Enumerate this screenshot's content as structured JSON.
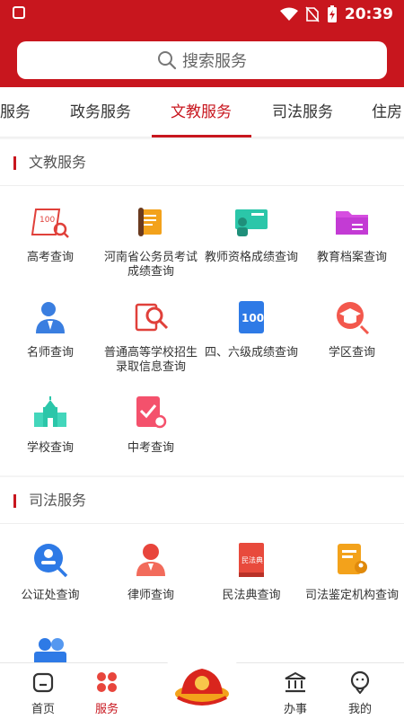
{
  "status": {
    "time": "20:39"
  },
  "search": {
    "placeholder": "搜索服务"
  },
  "tabs": [
    "服务",
    "政务服务",
    "文教服务",
    "司法服务",
    "住房"
  ],
  "sections": [
    {
      "title": "文教服务",
      "items": [
        {
          "label": "高考查询",
          "icon": "exam-paper-icon"
        },
        {
          "label": "河南省公务员考试成绩查询",
          "icon": "scroll-document-icon"
        },
        {
          "label": "教师资格成绩查询",
          "icon": "teacher-board-icon"
        },
        {
          "label": "教育档案查询",
          "icon": "folder-icon"
        },
        {
          "label": "名师查询",
          "icon": "teacher-person-icon"
        },
        {
          "label": "普通高等学校招生录取信息查询",
          "icon": "admission-search-icon"
        },
        {
          "label": "四、六级成绩查询",
          "icon": "score-100-icon"
        },
        {
          "label": "学区查询",
          "icon": "graduation-cap-icon"
        },
        {
          "label": "学校查询",
          "icon": "school-building-icon"
        },
        {
          "label": "中考查询",
          "icon": "document-check-icon"
        }
      ]
    },
    {
      "title": "司法服务",
      "items": [
        {
          "label": "公证处查询",
          "icon": "notary-icon"
        },
        {
          "label": "律师查询",
          "icon": "lawyer-icon"
        },
        {
          "label": "民法典查询",
          "icon": "civil-code-book-icon"
        },
        {
          "label": "司法鉴定机构查询",
          "icon": "judicial-appraisal-icon"
        },
        {
          "label": "",
          "icon": "video-person-icon"
        }
      ]
    }
  ],
  "civil_code_text": "民法典",
  "nav": [
    {
      "label": "首页",
      "icon": "home-icon"
    },
    {
      "label": "服务",
      "icon": "services-grid-icon"
    },
    {
      "label": "",
      "icon": "emblem-logo-icon"
    },
    {
      "label": "办事",
      "icon": "building-icon"
    },
    {
      "label": "我的",
      "icon": "profile-icon"
    }
  ],
  "colors": {
    "brand": "#c8161e",
    "background": "#f4f4f4"
  }
}
